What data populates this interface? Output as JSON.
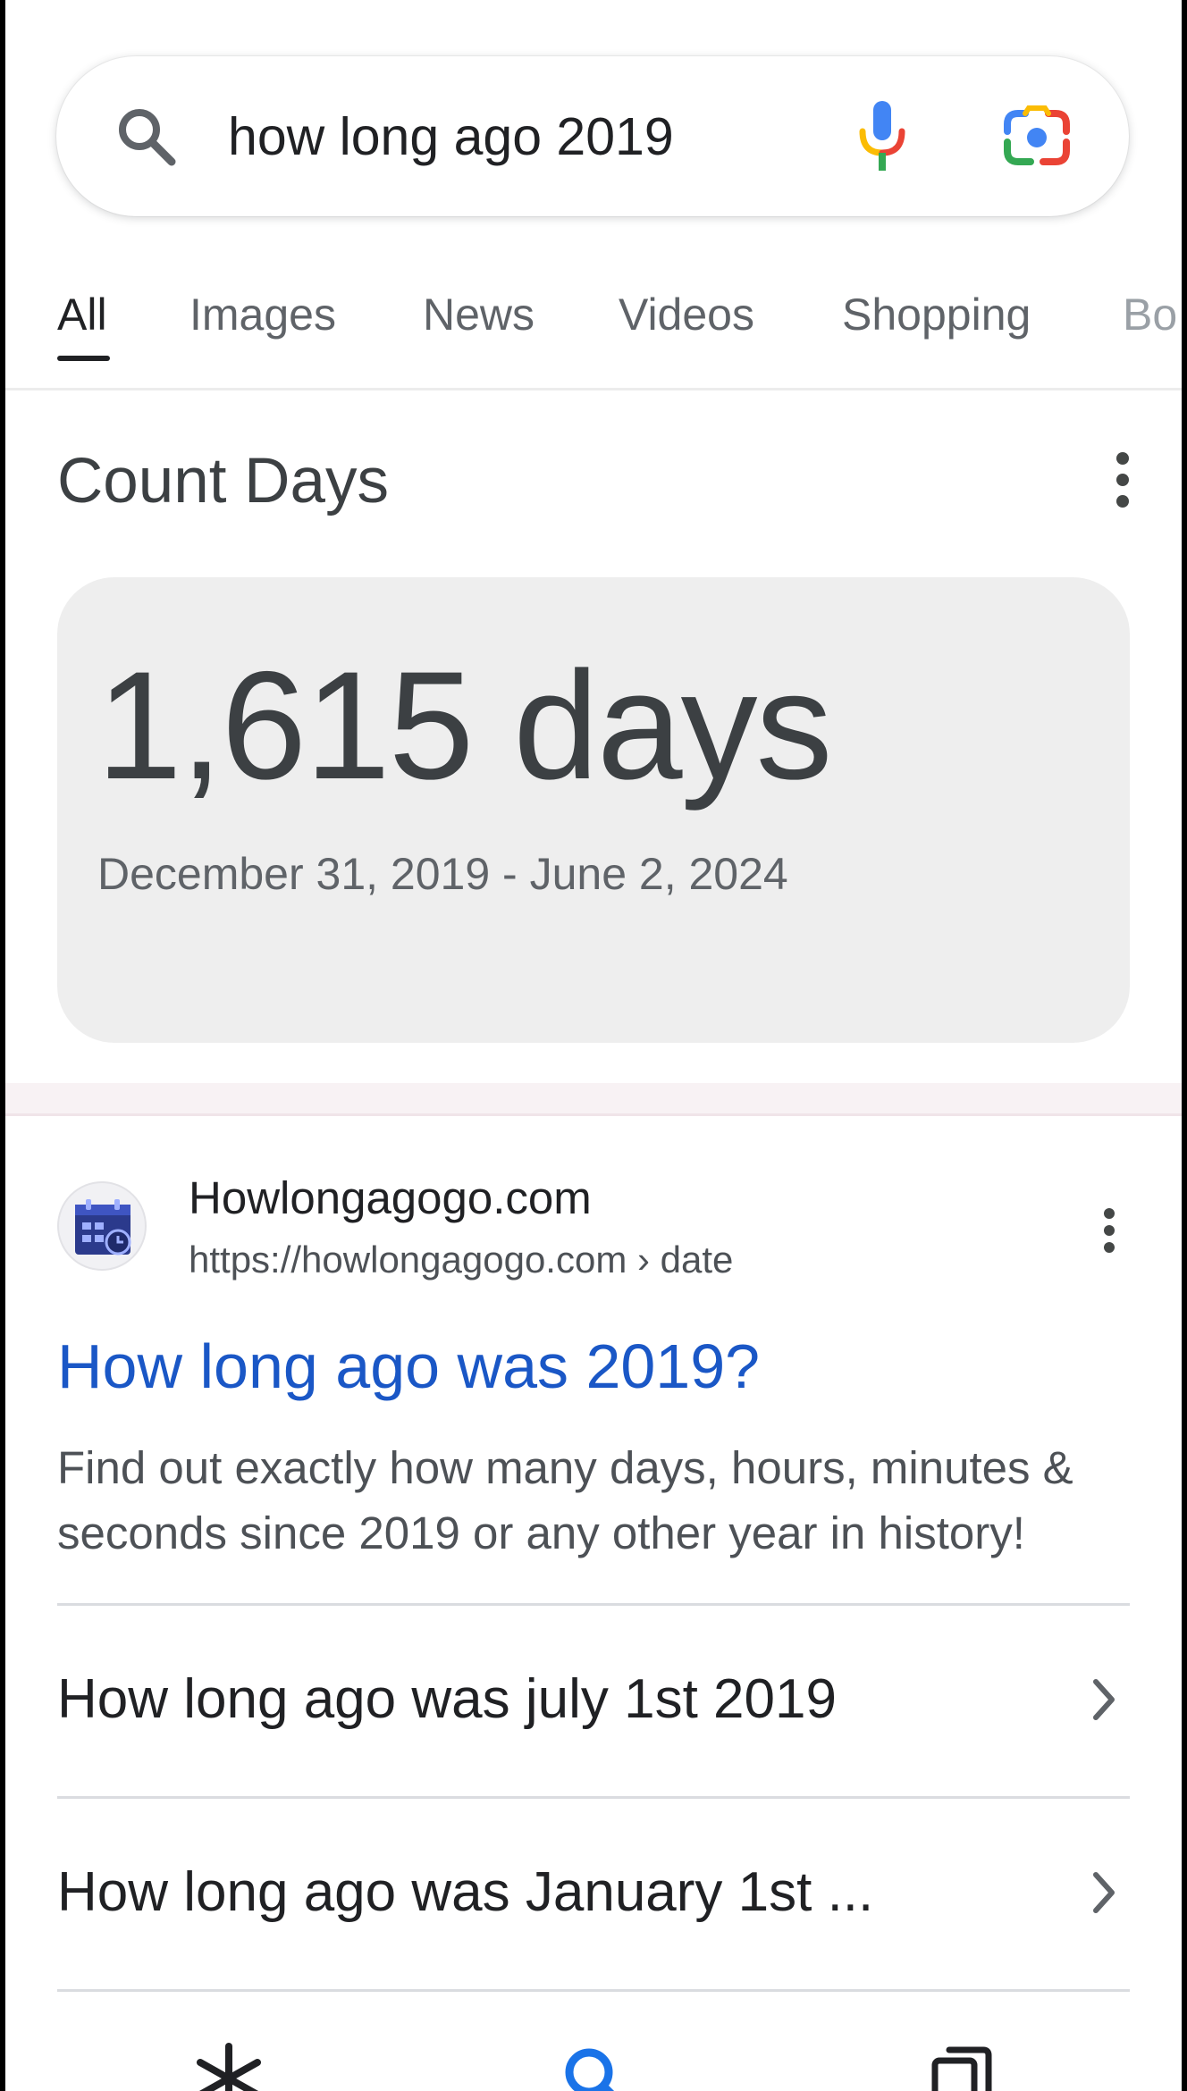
{
  "search": {
    "query": "how long ago 2019",
    "icons": {
      "search": "search-icon",
      "voice": "microphone-icon",
      "lens": "google-lens-camera-icon"
    }
  },
  "tabs": [
    {
      "label": "All",
      "active": true
    },
    {
      "label": "Images",
      "active": false
    },
    {
      "label": "News",
      "active": false
    },
    {
      "label": "Videos",
      "active": false
    },
    {
      "label": "Shopping",
      "active": false
    },
    {
      "label": "Bo",
      "active": false
    }
  ],
  "count_card": {
    "title": "Count Days",
    "value": "1,615 days",
    "range": "December 31, 2019 - June 2, 2024"
  },
  "result": {
    "site_name": "Howlongagogo.com",
    "url": "https://howlongagogo.com › date",
    "title": "How long ago was 2019?",
    "snippet": "Find out exactly how many days, hours, minutes & seconds since 2019 or any other year in history!",
    "favicon": "calendar-clock-icon"
  },
  "related": [
    {
      "label": "How long ago was july 1st 2019"
    },
    {
      "label": "How long ago was January 1st ..."
    }
  ],
  "bottom_nav": {
    "icons": [
      "discover-asterisk-icon",
      "search-icon",
      "tabs-icon"
    ]
  },
  "colors": {
    "link": "#1a57c6",
    "card_background": "#eeeeee",
    "text_primary": "#202124",
    "text_secondary": "#5f6368",
    "google_blue": "#4285f4",
    "google_red": "#ea4335",
    "google_yellow": "#fbbc04",
    "google_green": "#34a853"
  }
}
